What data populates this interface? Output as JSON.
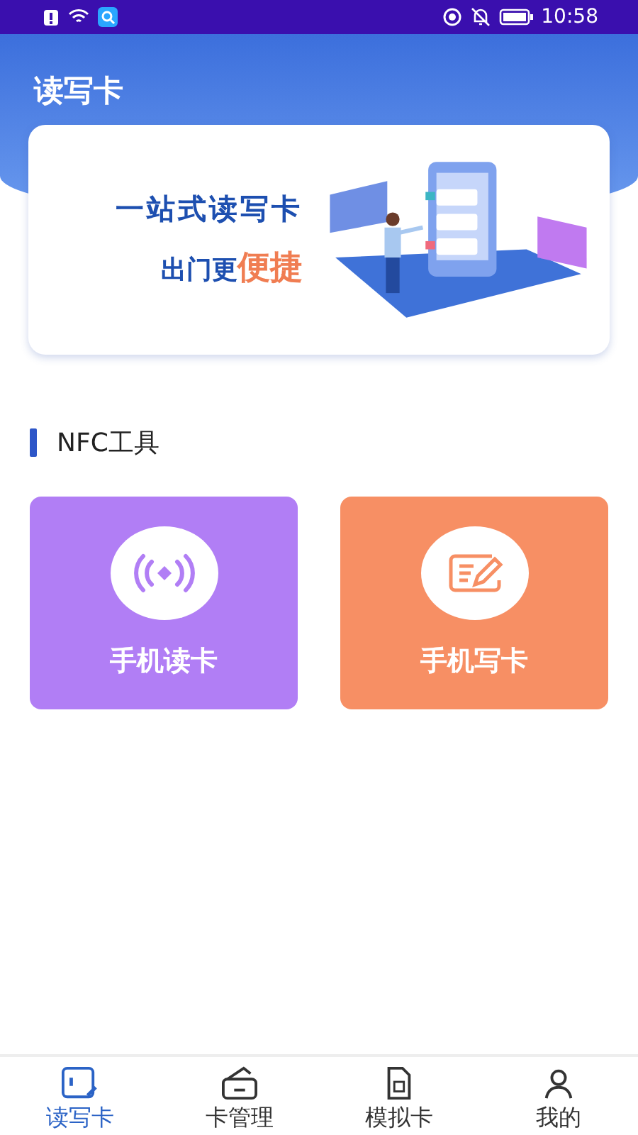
{
  "status_bar": {
    "time": "10:58"
  },
  "header": {
    "title": "读写卡"
  },
  "banner": {
    "headline": "一站式读写卡",
    "subline": "出门更",
    "highlight": "便捷"
  },
  "section": {
    "title": "NFC工具"
  },
  "tools": [
    {
      "label": "手机读卡",
      "kind": "read",
      "color": "#b17ef5"
    },
    {
      "label": "手机写卡",
      "kind": "write",
      "color": "#f78f64"
    }
  ],
  "tabs": [
    {
      "label": "读写卡",
      "selected": true,
      "kind": "card-edit"
    },
    {
      "label": "卡管理",
      "selected": false,
      "kind": "wallet"
    },
    {
      "label": "模拟卡",
      "selected": false,
      "kind": "sim"
    },
    {
      "label": "我的",
      "selected": false,
      "kind": "person"
    }
  ]
}
